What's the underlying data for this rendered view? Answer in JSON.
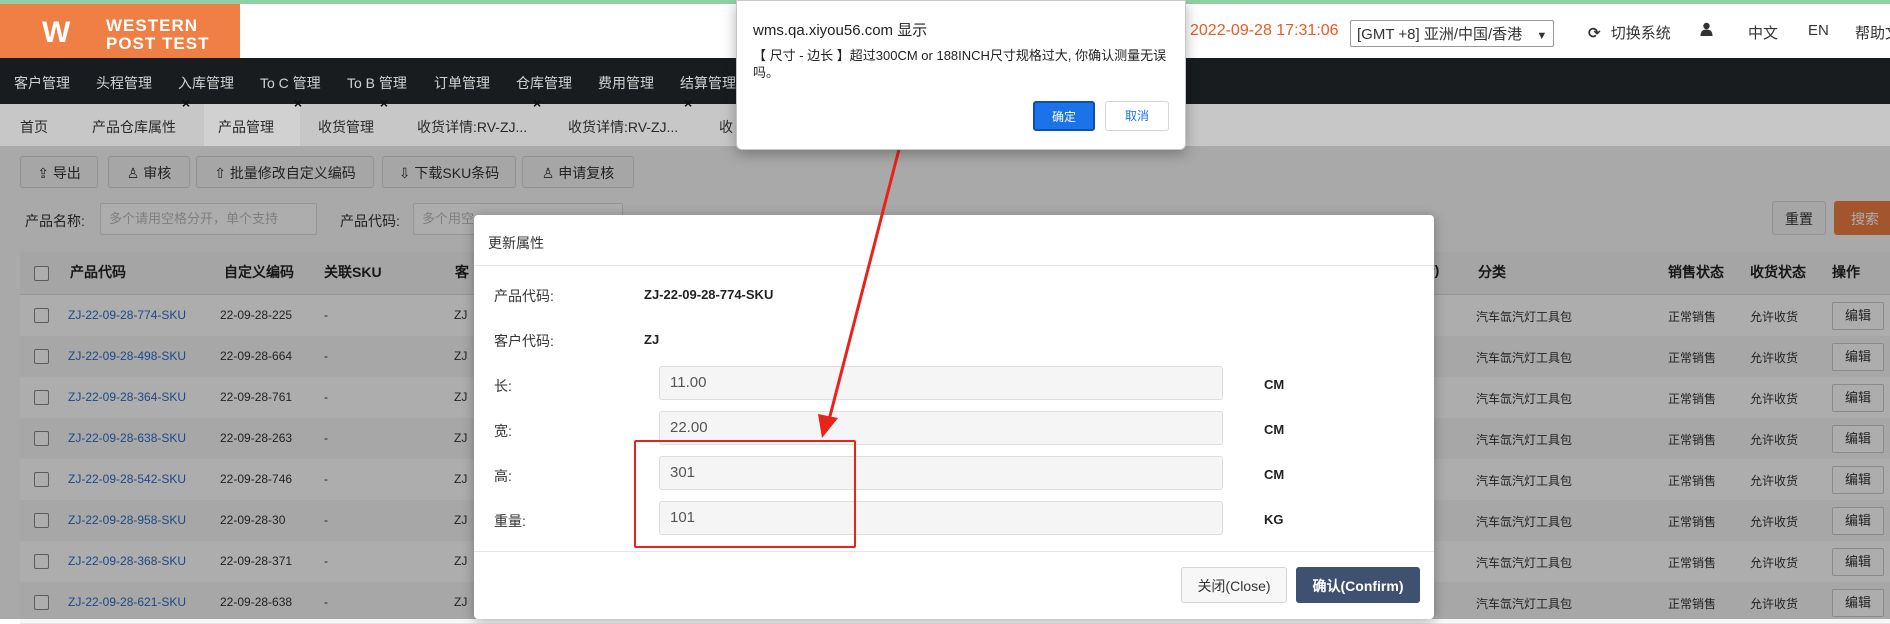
{
  "header": {
    "logo_mark": "W",
    "logo_line1": "WESTERN",
    "logo_line2": "POST TEST",
    "datetime": "2022-09-28 17:31:06",
    "timezone": "[GMT +8] 亚洲/中国/香港",
    "switch_system": "切换系统",
    "lang_zh": "中文",
    "lang_en": "EN",
    "help": "帮助文"
  },
  "nav": [
    "客户管理",
    "头程管理",
    "入库管理",
    "To C 管理",
    "To B 管理",
    "订单管理",
    "仓库管理",
    "费用管理",
    "结算管理"
  ],
  "tabs": [
    "首页",
    "产品仓库属性",
    "产品管理",
    "收货管理",
    "收货详情:RV-ZJ...",
    "收货详情:RV-ZJ...",
    "收"
  ],
  "toolbar": {
    "export": "导出",
    "audit": "审核",
    "batch_edit": "批量修改自定义编码",
    "download_sku": "下载SKU条码",
    "apply_recheck": "申请复核"
  },
  "search": {
    "product_name_label": "产品名称:",
    "product_name_placeholder": "多个请用空格分开，单个支持",
    "product_code_label": "产品代码:",
    "product_code_placeholder": "多个用空",
    "reset": "重置",
    "search": "搜索"
  },
  "table": {
    "headers": {
      "code": "产品代码",
      "custom": "自定义编码",
      "sku": "关联SKU",
      "cust": "客",
      "vol": "³)",
      "cat": "分类",
      "sale": "销售状态",
      "recv": "收货状态",
      "op": "操作"
    },
    "rows": [
      {
        "code": "ZJ-22-09-28-774-SKU",
        "custom": "22-09-28-225",
        "sku": "-",
        "cust": "ZJ",
        "cat": "汽车氙汽灯工具包",
        "sale": "正常销售",
        "recv": "允许收货",
        "op": "编辑"
      },
      {
        "code": "ZJ-22-09-28-498-SKU",
        "custom": "22-09-28-664",
        "sku": "-",
        "cust": "ZJ",
        "cat": "汽车氙汽灯工具包",
        "sale": "正常销售",
        "recv": "允许收货",
        "op": "编辑"
      },
      {
        "code": "ZJ-22-09-28-364-SKU",
        "custom": "22-09-28-761",
        "sku": "-",
        "cust": "ZJ",
        "cat": "汽车氙汽灯工具包",
        "sale": "正常销售",
        "recv": "允许收货",
        "op": "编辑"
      },
      {
        "code": "ZJ-22-09-28-638-SKU",
        "custom": "22-09-28-263",
        "sku": "-",
        "cust": "ZJ",
        "cat": "汽车氙汽灯工具包",
        "sale": "正常销售",
        "recv": "允许收货",
        "op": "编辑"
      },
      {
        "code": "ZJ-22-09-28-542-SKU",
        "custom": "22-09-28-746",
        "sku": "-",
        "cust": "ZJ",
        "cat": "汽车氙汽灯工具包",
        "sale": "正常销售",
        "recv": "允许收货",
        "op": "编辑"
      },
      {
        "code": "ZJ-22-09-28-958-SKU",
        "custom": "22-09-28-30",
        "sku": "-",
        "cust": "ZJ",
        "cat": "汽车氙汽灯工具包",
        "sale": "正常销售",
        "recv": "允许收货",
        "op": "编辑"
      },
      {
        "code": "ZJ-22-09-28-368-SKU",
        "custom": "22-09-28-371",
        "sku": "-",
        "cust": "ZJ",
        "cat": "汽车氙汽灯工具包",
        "sale": "正常销售",
        "recv": "允许收货",
        "op": "编辑"
      },
      {
        "code": "ZJ-22-09-28-621-SKU",
        "custom": "22-09-28-638",
        "sku": "-",
        "cust": "ZJ",
        "cat": "汽车氙汽灯工具包",
        "sale": "正常销售",
        "recv": "允许收货",
        "op": "编辑"
      }
    ]
  },
  "modal": {
    "title": "更新属性",
    "product_code_label": "产品代码:",
    "product_code": "ZJ-22-09-28-774-SKU",
    "customer_code_label": "客户代码:",
    "customer_code": "ZJ",
    "length_label": "长:",
    "length": "11.00",
    "length_unit": "CM",
    "width_label": "宽:",
    "width": "22.00",
    "width_unit": "CM",
    "height_label": "高:",
    "height": "301",
    "height_unit": "CM",
    "weight_label": "重量:",
    "weight": "101",
    "weight_unit": "KG",
    "close": "关闭(Close)",
    "confirm": "确认(Confirm)"
  },
  "alert": {
    "origin": "wms.qa.xiyou56.com 显示",
    "message": "【 尺寸 - 边长 】超过300CM or 188INCH尺寸规格过大, 你确认测量无误吗。",
    "ok": "确定",
    "cancel": "取消"
  },
  "colors": {
    "brand": "#f07f45",
    "nav_bg": "#1f2326",
    "link": "#2d6cc6",
    "annotation": "#e8241a",
    "confirm_btn": "#3f5170",
    "alert_ok": "#1a73e8"
  }
}
